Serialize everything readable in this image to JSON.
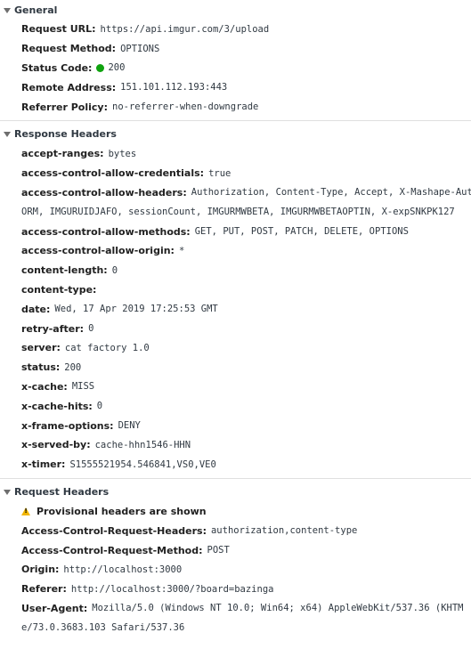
{
  "general": {
    "title": "General",
    "rows": [
      {
        "key": "Request URL:",
        "value": "https://api.imgur.com/3/upload"
      },
      {
        "key": "Request Method:",
        "value": "OPTIONS"
      },
      {
        "key": "Status Code:",
        "value": "200"
      },
      {
        "key": "Remote Address:",
        "value": "151.101.112.193:443"
      },
      {
        "key": "Referrer Policy:",
        "value": "no-referrer-when-downgrade"
      }
    ],
    "status_color": "#0fa30f"
  },
  "response": {
    "title": "Response Headers",
    "rows": [
      {
        "key": "accept-ranges:",
        "value": "bytes"
      },
      {
        "key": "access-control-allow-credentials:",
        "value": "true"
      },
      {
        "key": "access-control-allow-headers:",
        "value": "Authorization, Content-Type, Accept, X-Mashape-Aut"
      },
      {
        "key": "",
        "value": "ORM, IMGURUIDJAFO, sessionCount, IMGURMWBETA, IMGURMWBETAOPTIN, X-expSNKPK127"
      },
      {
        "key": "access-control-allow-methods:",
        "value": "GET, PUT, POST, PATCH, DELETE, OPTIONS"
      },
      {
        "key": "access-control-allow-origin:",
        "value": "*"
      },
      {
        "key": "content-length:",
        "value": "0"
      },
      {
        "key": "content-type:",
        "value": ""
      },
      {
        "key": "date:",
        "value": "Wed, 17 Apr 2019 17:25:53 GMT"
      },
      {
        "key": "retry-after:",
        "value": "0"
      },
      {
        "key": "server:",
        "value": "cat factory 1.0"
      },
      {
        "key": "status:",
        "value": "200"
      },
      {
        "key": "x-cache:",
        "value": "MISS"
      },
      {
        "key": "x-cache-hits:",
        "value": "0"
      },
      {
        "key": "x-frame-options:",
        "value": "DENY"
      },
      {
        "key": "x-served-by:",
        "value": "cache-hhn1546-HHN"
      },
      {
        "key": "x-timer:",
        "value": "S1555521954.546841,VS0,VE0"
      }
    ]
  },
  "request": {
    "title": "Request Headers",
    "provisional_label": "Provisional headers are shown",
    "warning_color": "#f2b600",
    "rows": [
      {
        "key": "Access-Control-Request-Headers:",
        "value": "authorization,content-type"
      },
      {
        "key": "Access-Control-Request-Method:",
        "value": "POST"
      },
      {
        "key": "Origin:",
        "value": "http://localhost:3000"
      },
      {
        "key": "Referer:",
        "value": "http://localhost:3000/?board=bazinga"
      },
      {
        "key": "User-Agent:",
        "value": "Mozilla/5.0 (Windows NT 10.0; Win64; x64) AppleWebKit/537.36 (KHTM"
      },
      {
        "key": "",
        "value": "e/73.0.3683.103 Safari/537.36"
      }
    ]
  }
}
